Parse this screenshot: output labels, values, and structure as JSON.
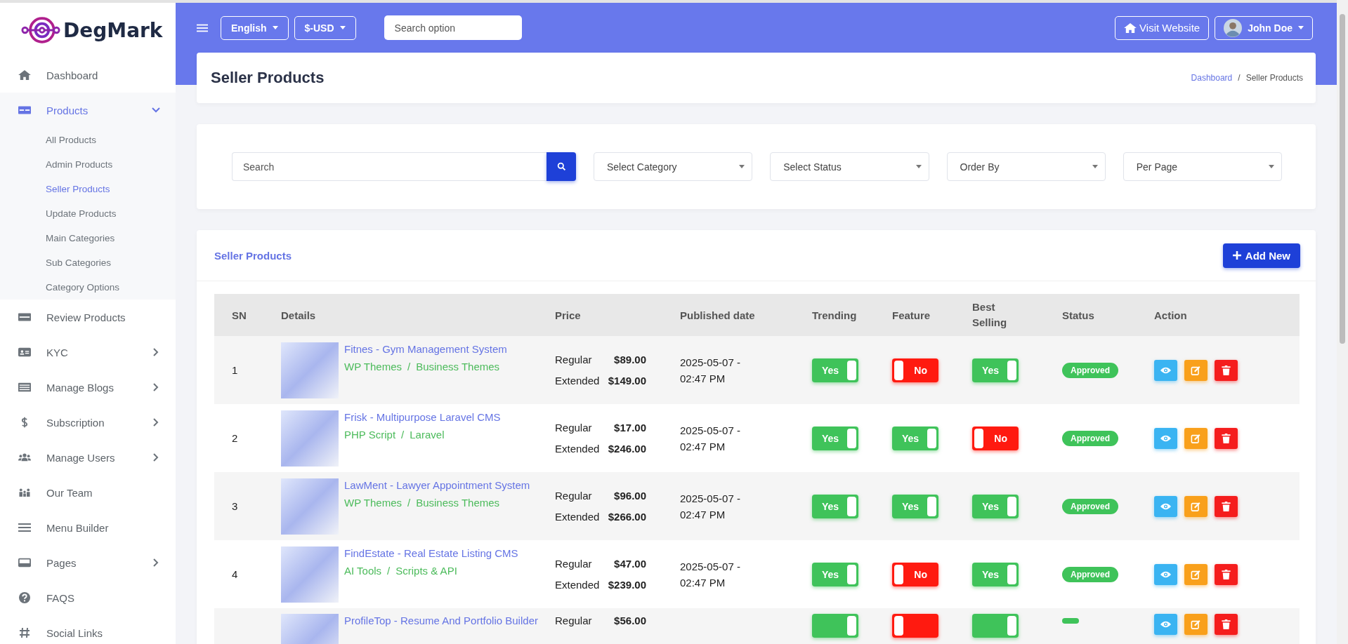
{
  "brand": {
    "name": "DegMark"
  },
  "sidebar": {
    "items": [
      {
        "label": "Dashboard",
        "selected": false
      },
      {
        "label": "Products",
        "selected": true,
        "expanded": true,
        "children": [
          {
            "label": "All Products",
            "selected": false
          },
          {
            "label": "Admin Products",
            "selected": false
          },
          {
            "label": "Seller Products",
            "selected": true
          },
          {
            "label": "Update Products",
            "selected": false
          },
          {
            "label": "Main Categories",
            "selected": false
          },
          {
            "label": "Sub Categories",
            "selected": false
          },
          {
            "label": "Category Options",
            "selected": false
          }
        ]
      },
      {
        "label": "Review Products",
        "selected": false
      },
      {
        "label": "KYC",
        "selected": false,
        "expanded": false
      },
      {
        "label": "Manage Blogs",
        "selected": false,
        "expanded": false
      },
      {
        "label": "Subscription",
        "selected": false,
        "expanded": false
      },
      {
        "label": "Manage Users",
        "selected": false,
        "expanded": false
      },
      {
        "label": "Our Team",
        "selected": false
      },
      {
        "label": "Menu Builder",
        "selected": false
      },
      {
        "label": "Pages",
        "selected": false,
        "expanded": false
      },
      {
        "label": "FAQS",
        "selected": false
      },
      {
        "label": "Social Links",
        "selected": false
      }
    ]
  },
  "topbar": {
    "language": "English",
    "currency": "$-USD",
    "search": {
      "placeholder": "Search option"
    },
    "visit_button": "Visit Website",
    "user": "John Doe"
  },
  "page_header": {
    "title": "Seller Products",
    "breadcrumb": [
      "Dashboard",
      "Seller Products"
    ],
    "breadcrumb_separator": "/"
  },
  "filters": {
    "search": {
      "placeholder": "Search"
    },
    "selects": [
      "Select Category",
      "Select Status",
      "Order By",
      "Per Page"
    ]
  },
  "table": {
    "title": "Seller Products",
    "add_button": "Add New",
    "category_separator": "/",
    "columns": [
      "SN",
      "Details",
      "Price",
      "Published date",
      "Trending",
      "Feature",
      "Best Selling",
      "Status",
      "Action"
    ],
    "rows": [
      {
        "sn": "1",
        "title": "Fitnes - Gym Management System",
        "categories": [
          "WP Themes",
          "Business Themes"
        ],
        "regular_label": "Regular",
        "regular": "$89.00",
        "extended_label": "Extended",
        "extended": "$149.00",
        "date": "2025-05-07 -",
        "time": "02:47 PM",
        "trending": {
          "label": "Yes",
          "on": true
        },
        "feature": {
          "label": "No",
          "on": false
        },
        "best_selling": {
          "label": "Yes",
          "on": true
        },
        "status": "Approved"
      },
      {
        "sn": "2",
        "title": "Frisk - Multipurpose Laravel CMS",
        "categories": [
          "PHP Script",
          "Laravel"
        ],
        "regular_label": "Regular",
        "regular": "$17.00",
        "extended_label": "Extended",
        "extended": "$246.00",
        "date": "2025-05-07 -",
        "time": "02:47 PM",
        "trending": {
          "label": "Yes",
          "on": true
        },
        "feature": {
          "label": "Yes",
          "on": true
        },
        "best_selling": {
          "label": "No",
          "on": false
        },
        "status": "Approved"
      },
      {
        "sn": "3",
        "title": "LawMent - Lawyer Appointment System",
        "categories": [
          "WP Themes",
          "Business Themes"
        ],
        "regular_label": "Regular",
        "regular": "$96.00",
        "extended_label": "Extended",
        "extended": "$266.00",
        "date": "2025-05-07 -",
        "time": "02:47 PM",
        "trending": {
          "label": "Yes",
          "on": true
        },
        "feature": {
          "label": "Yes",
          "on": true
        },
        "best_selling": {
          "label": "Yes",
          "on": true
        },
        "status": "Approved"
      },
      {
        "sn": "4",
        "title": "FindEstate - Real Estate Listing CMS",
        "categories": [
          "AI Tools",
          "Scripts & API"
        ],
        "regular_label": "Regular",
        "regular": "$47.00",
        "extended_label": "Extended",
        "extended": "$239.00",
        "date": "2025-05-07 -",
        "time": "02:47 PM",
        "trending": {
          "label": "Yes",
          "on": true
        },
        "feature": {
          "label": "No",
          "on": false
        },
        "best_selling": {
          "label": "Yes",
          "on": true
        },
        "status": "Approved"
      },
      {
        "title": "ProfileTop - Resume And Portfolio Builder",
        "regular_label": "Regular",
        "regular": "$56.00",
        "trending": {
          "on": true
        },
        "feature": {
          "on": false
        },
        "best_selling": {
          "on": true
        }
      }
    ]
  }
}
